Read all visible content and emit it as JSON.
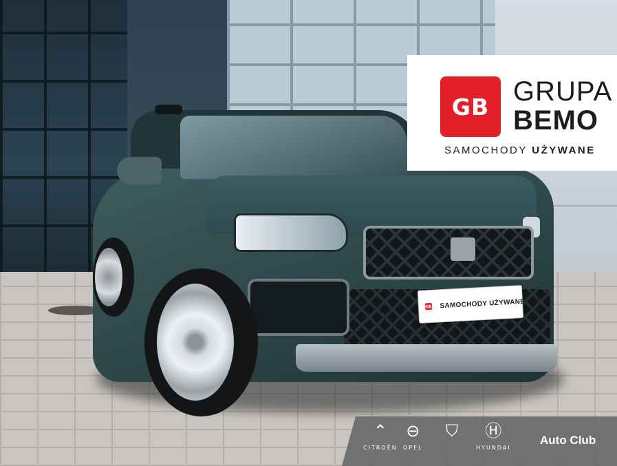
{
  "logo": {
    "mark": "GB",
    "line1": "GRUPA",
    "line2": "BEMO",
    "tagline_part1": "SAMOCHODY ",
    "tagline_part2": "UŻYWANE",
    "brand_color": "#e3202a"
  },
  "plate": {
    "mark": "GB",
    "text": "SAMOCHODY UŻYWANE"
  },
  "brands": [
    {
      "name": "CITROËN",
      "icon": "citroen-chevrons-icon"
    },
    {
      "name": "OPEL",
      "icon": "opel-lightning-icon"
    },
    {
      "name": "",
      "icon": "peugeot-lion-icon"
    },
    {
      "name": "HYUNDAI",
      "icon": "hyundai-h-icon"
    }
  ],
  "autoclub": "Auto Club"
}
